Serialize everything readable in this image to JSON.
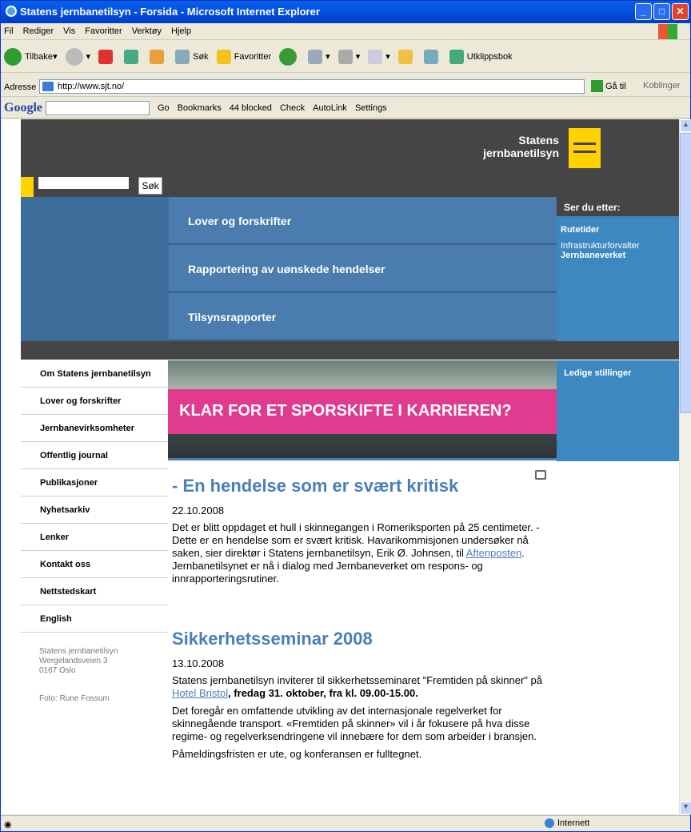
{
  "window": {
    "title": "Statens jernbanetilsyn - Forsida - Microsoft Internet Explorer"
  },
  "menubar": [
    "Fil",
    "Rediger",
    "Vis",
    "Favoritter",
    "Verktøy",
    "Hjelp"
  ],
  "toolbar": {
    "back": "Tilbake",
    "search": "Søk",
    "favorites": "Favoritter",
    "clipboard": "Utklippsbok"
  },
  "address": {
    "label": "Adresse",
    "url": "http://www.sjt.no/",
    "go": "Gå til",
    "links": "Koblinger"
  },
  "googlebar": {
    "logo": "Google",
    "go": "Go",
    "bookmarks": "Bookmarks",
    "blocked": "44 blocked",
    "check": "Check",
    "autolink": "AutoLink",
    "settings": "Settings"
  },
  "site": {
    "logo_line1": "Statens",
    "logo_line2": "jernbanetilsyn",
    "search_button": "Søk",
    "nav": [
      "Lover og forskrifter",
      "Rapportering av uønskede hendelser",
      "Tilsynsrapporter"
    ],
    "right": {
      "heading": "Ser du etter:",
      "link1": "Rutetider",
      "link2": "Infrastrukturforvalter",
      "link3": "Jernbaneverket",
      "jobs": "Ledige stillinger"
    },
    "leftnav": [
      "Om Statens jernbanetilsyn",
      "Lover og forskrifter",
      "Jernbanevirksomheter",
      "Offentlig journal",
      "Publikasjoner",
      "Nyhetsarkiv",
      "Lenker",
      "Kontakt oss",
      "Nettstedskart",
      "English"
    ],
    "address": [
      "Statens jernbanetilsyn",
      "Wergelandsveien 3",
      "0167 Oslo"
    ],
    "photo": "Foto: Rune Fossum",
    "banner": "KLAR FOR ET SPORSKIFTE I KARRIEREN?"
  },
  "articles": [
    {
      "title": "- En hendelse som er svært kritisk",
      "date": "22.10.2008",
      "p1_a": "Det er blitt oppdaget et hull i skinnegangen i Romeriksporten på 25 centimeter. - Dette er en hendelse som er svært kritisk. Havarikommisjonen undersøker nå saken, sier direktør i Statens jernbanetilsyn, Erik Ø. Johnsen, til ",
      "p1_link": "Aftenposten",
      "p1_b": ". Jernbanetilsynet er nå i dialog med Jernbaneverket om respons- og innrapporteringsrutiner."
    },
    {
      "title": "Sikkerhetsseminar 2008",
      "date": "13.10.2008",
      "p1_a": "Statens jernbanetilsyn inviterer til sikkerhetsseminaret \"Fremtiden på skinner\" på ",
      "p1_link": "Hotel Bristol",
      "p1_bold": ", fredag 31. oktober, fra kl. 09.00-15.00.",
      "p2": "Det foregår en omfattende utvikling av det internasjonale regelverket for skinnegående transport. «Fremtiden på skinner» vil i år fokusere på hva disse regime- og regelverksendringene vil innebære for dem som arbeider i bransjen.",
      "p3": "Påmeldingsfristen er ute, og konferansen er fulltegnet."
    }
  ],
  "status": {
    "zone": "Internett"
  }
}
